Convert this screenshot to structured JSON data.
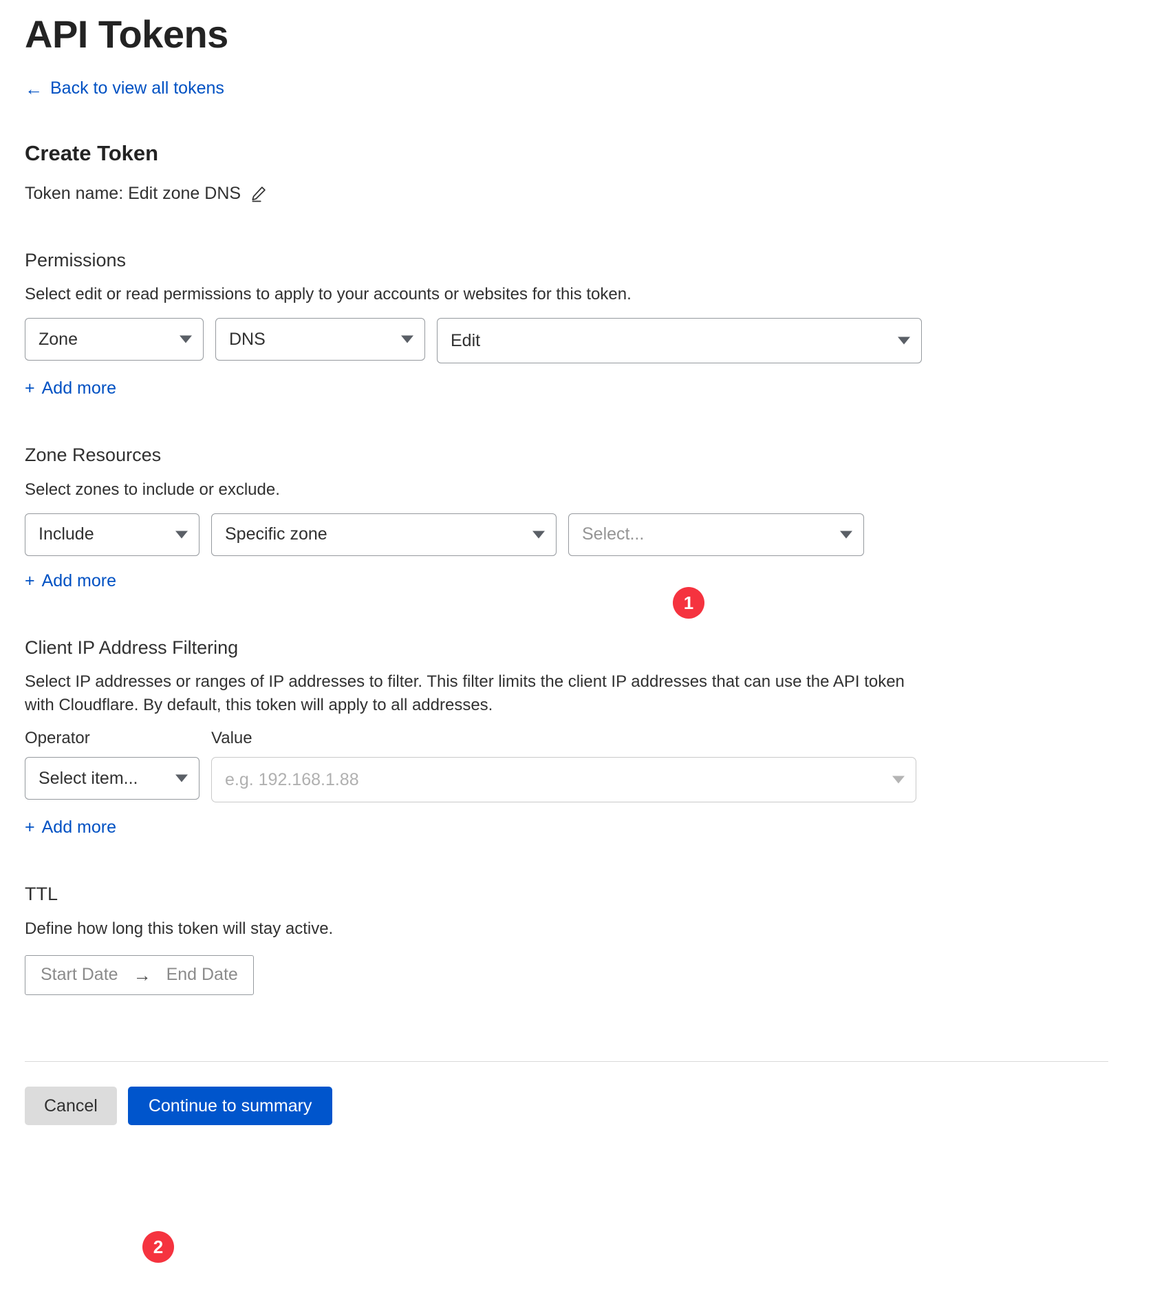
{
  "header": {
    "title": "API Tokens",
    "back_link": "Back to view all tokens",
    "back_arrow": "←"
  },
  "create": {
    "heading": "Create Token",
    "token_name_label": "Token name: Edit zone DNS",
    "edit_icon": "pencil-icon"
  },
  "permissions": {
    "title": "Permissions",
    "description": "Select edit or read permissions to apply to your accounts or websites for this token.",
    "resource_group": "Zone",
    "resource": "DNS",
    "access": "Edit",
    "add_more": "Add more",
    "plus": "+"
  },
  "zone_resources": {
    "title": "Zone Resources",
    "description": "Select zones to include or exclude.",
    "inclusion": "Include",
    "scope": "Specific zone",
    "zone_placeholder": "Select...",
    "add_more": "Add more",
    "plus": "+"
  },
  "ip_filtering": {
    "title": "Client IP Address Filtering",
    "description": "Select IP addresses or ranges of IP addresses to filter. This filter limits the client IP addresses that can use the API token with Cloudflare. By default, this token will apply to all addresses.",
    "operator_label": "Operator",
    "value_label": "Value",
    "operator_value": "Select item...",
    "value_placeholder": "e.g. 192.168.1.88",
    "add_more": "Add more",
    "plus": "+"
  },
  "ttl": {
    "title": "TTL",
    "description": "Define how long this token will stay active.",
    "start_date": "Start Date",
    "arrow": "→",
    "end_date": "End Date"
  },
  "footer": {
    "cancel": "Cancel",
    "continue": "Continue to summary"
  },
  "annotations": {
    "step_1": "1",
    "step_2": "2"
  },
  "colors": {
    "link": "#0051c3",
    "primary_button": "#0055cc",
    "badge": "#f5333f",
    "text": "#313131",
    "border": "#95999e"
  }
}
